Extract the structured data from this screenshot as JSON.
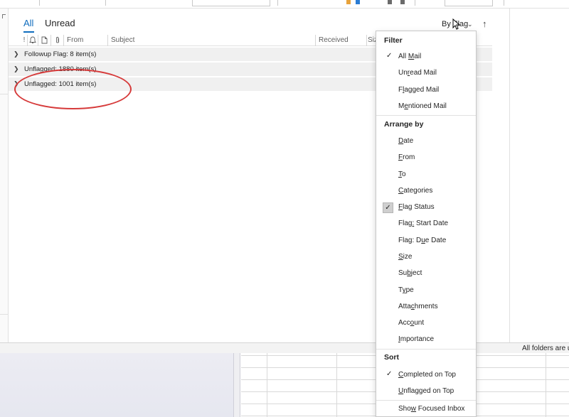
{
  "tabs": {
    "all": "All",
    "unread": "Unread"
  },
  "sort": {
    "label": "By Flag",
    "chevron": "⌄",
    "direction": "↑"
  },
  "columns": {
    "importance": "!",
    "reminder_icon": "bell-icon",
    "doc_icon": "document-icon",
    "attach_icon": "paperclip-icon",
    "from": "From",
    "subject": "Subject",
    "received": "Received",
    "size": "Siz"
  },
  "groups": [
    {
      "label": "Followup Flag: 8 item(s)"
    },
    {
      "label": "Unflagged: 1880 item(s)"
    },
    {
      "label": "Unflagged: 1001 item(s)"
    }
  ],
  "menu": {
    "filter_header": "Filter",
    "filter_items": [
      {
        "pre": "All ",
        "acc": "M",
        "post": "ail",
        "checked": true
      },
      {
        "pre": "Un",
        "acc": "r",
        "post": "ead Mail"
      },
      {
        "pre": "F",
        "acc": "l",
        "post": "agged Mail"
      },
      {
        "pre": "M",
        "acc": "e",
        "post": "ntioned Mail"
      }
    ],
    "arrange_header": "Arrange by",
    "arrange_items": [
      {
        "pre": "",
        "acc": "D",
        "post": "ate"
      },
      {
        "pre": "",
        "acc": "F",
        "post": "rom"
      },
      {
        "pre": "",
        "acc": "T",
        "post": "o"
      },
      {
        "pre": "",
        "acc": "C",
        "post": "ategories"
      },
      {
        "pre": "",
        "acc": "F",
        "post": "lag Status",
        "checked": true
      },
      {
        "pre": "Flag",
        "acc": ":",
        "post": " Start Date"
      },
      {
        "pre": "Flag: D",
        "acc": "u",
        "post": "e Date"
      },
      {
        "pre": "",
        "acc": "S",
        "post": "ize"
      },
      {
        "pre": "Su",
        "acc": "b",
        "post": "ject"
      },
      {
        "pre": "T",
        "acc": "y",
        "post": "pe"
      },
      {
        "pre": "Atta",
        "acc": "c",
        "post": "hments"
      },
      {
        "pre": "Acc",
        "acc": "o",
        "post": "unt"
      },
      {
        "pre": "",
        "acc": "I",
        "post": "mportance"
      }
    ],
    "sort_header": "Sort",
    "sort_items": [
      {
        "pre": "",
        "acc": "C",
        "post": "ompleted on Top",
        "checked": true
      },
      {
        "pre": "",
        "acc": "U",
        "post": "nflagged on Top"
      }
    ],
    "extra_items": [
      {
        "pre": "Sho",
        "acc": "w",
        "post": " Focused Inbox"
      }
    ],
    "check_glyph": "✓"
  },
  "status": {
    "text": "All folders are u"
  },
  "colors": {
    "accent": "#0f6cbd",
    "highlight_ring": "#d63a3a",
    "group_bg": "#f0f0f0"
  }
}
